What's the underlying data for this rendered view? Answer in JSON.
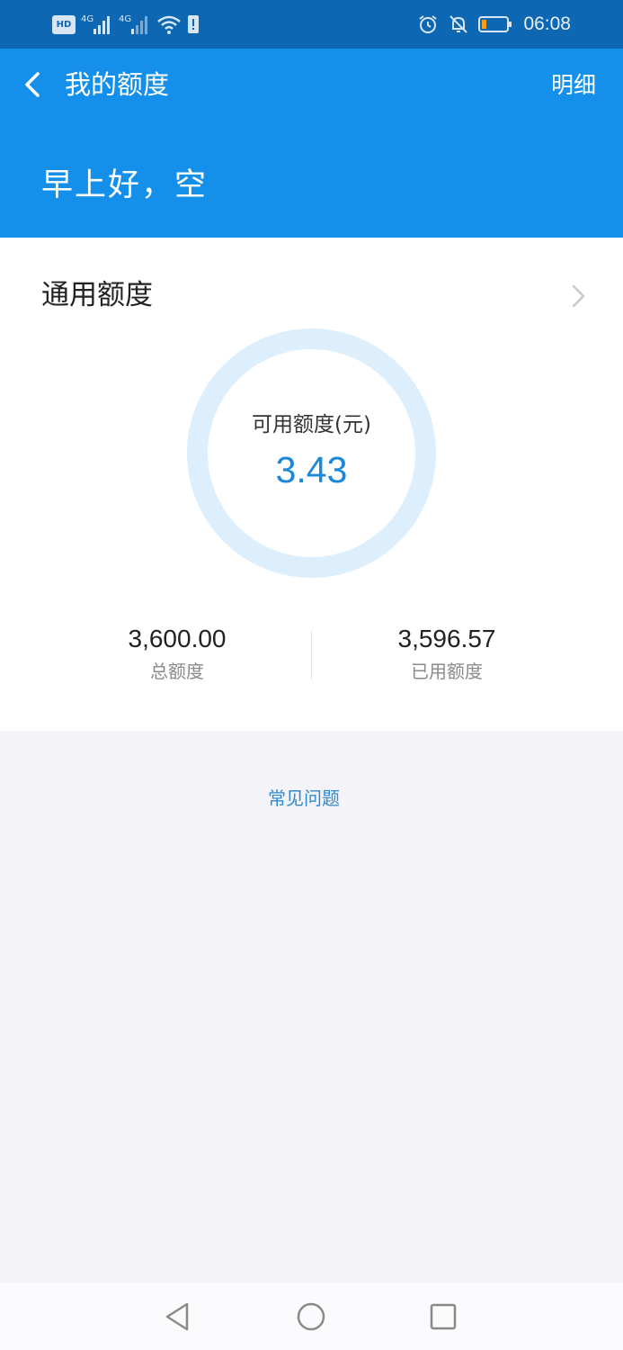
{
  "status_bar": {
    "hd_label": "HD",
    "network_1": "4G",
    "network_2": "4G",
    "time": "06:08",
    "battery_color": "#f6a01a"
  },
  "header": {
    "title": "我的额度",
    "detail_label": "明细",
    "greeting": "早上好，空",
    "background": "#1590ea"
  },
  "quota_card": {
    "title": "通用额度",
    "ring_label": "可用额度(元)",
    "available": "3.43",
    "total_value": "3,600.00",
    "total_label": "总额度",
    "used_value": "3,596.57",
    "used_label": "已用额度"
  },
  "faq": {
    "label": "常见问题"
  },
  "nav_bar": {
    "back_icon": "triangle-back-icon",
    "home_icon": "circle-home-icon",
    "recent_icon": "square-recent-icon"
  }
}
